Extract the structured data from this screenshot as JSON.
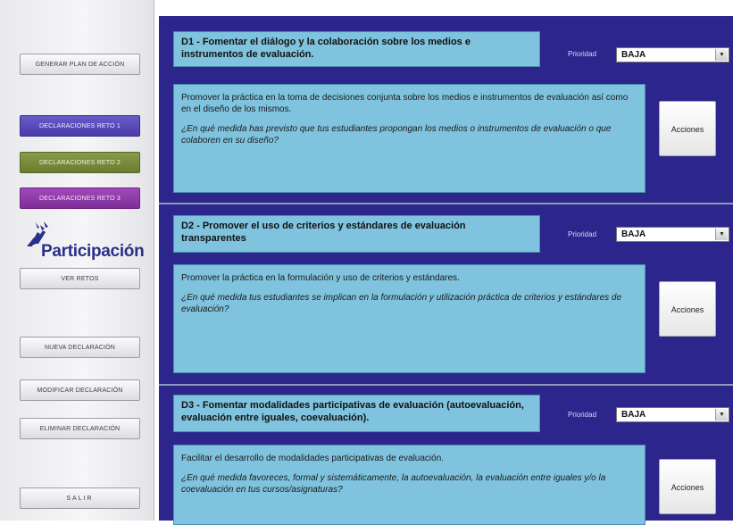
{
  "sidebar": {
    "buttons": {
      "generar": "GENERAR PLAN DE ACCIÓN",
      "reto1": "DECLARACIONES RETO 1",
      "reto2": "DECLARACIONES RETO 2",
      "reto3": "DECLARACIONES RETO 3",
      "ver_retos": "VER RETOS",
      "nueva": "NUEVA DECLARACIÓN",
      "modificar": "MODIFICAR DECLARACIÓN",
      "eliminar": "ELIMINAR DECLARACIÓN",
      "salir": "SALIR"
    },
    "logo_text": "Participación"
  },
  "priority_label": "Prioridad",
  "actions_label": "Acciones",
  "declarations": [
    {
      "title": "D1 - Fomentar el diálogo y la colaboración sobre los medios e instrumentos de evaluación.",
      "priority": "BAJA",
      "description": "Promover la práctica en la toma de decisiones conjunta sobre los medios e instrumentos de evaluación así como en el diseño de los mismos.",
      "question": "¿En qué medida has previsto que tus estudiantes propongan los medios o instrumentos de evaluación o que colaboren en su diseño?"
    },
    {
      "title": "D2 - Promover el uso de criterios y estándares de evaluación transparentes",
      "priority": "BAJA",
      "description": "Promover la práctica en la formulación y uso de criterios y estándares.",
      "question": "¿En qué medida tus estudiantes se implican en la formulación y utilización práctica de criterios y estándares de evaluación?"
    },
    {
      "title": "D3 - Fomentar modalidades participativas de evaluación (autoevaluación, evaluación entre iguales, coevaluación).",
      "priority": "BAJA",
      "description": "Facilitar el desarrollo de modalidades participativas de evaluación.",
      "question": "¿En qué medida favoreces, formal y sistemáticamente, la autoevaluación, la evaluación entre iguales y/o la coevaluación en tus cursos/asignaturas?"
    }
  ],
  "colors": {
    "main_bg": "#2c258c",
    "card_bg": "#7fc3de",
    "reto1": "#4a3ca8",
    "reto2": "#6a7c2e",
    "reto3": "#7e2e98"
  },
  "icons": {
    "dropdown": "chevron-down-icon",
    "logo": "participation-hands-icon"
  }
}
